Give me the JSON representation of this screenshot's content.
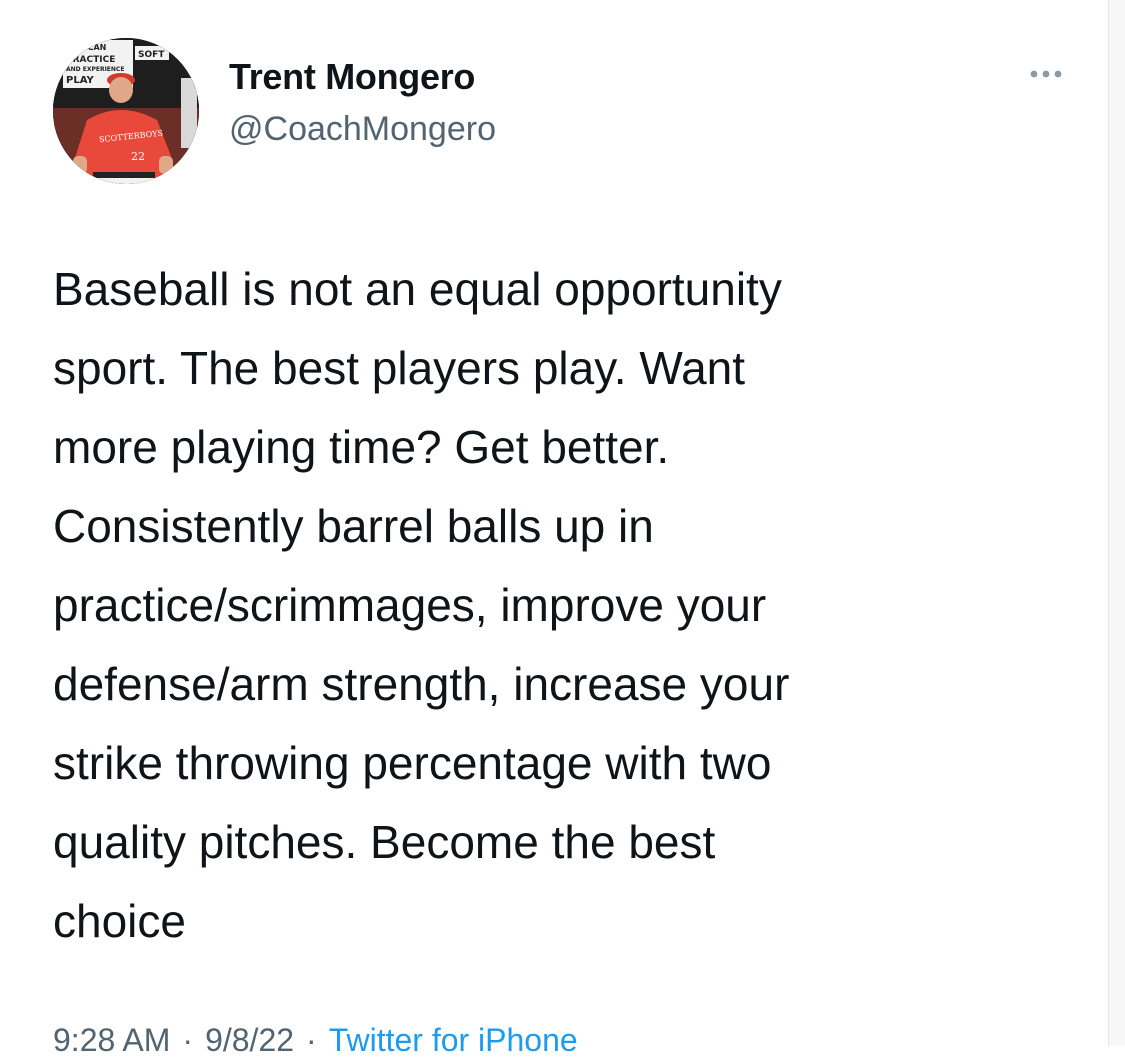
{
  "tweet": {
    "author": {
      "display_name": "Trent Mongero",
      "handle": "@CoachMongero"
    },
    "body": "Baseball is not an equal opportunity\nsport. The best players play. Want\nmore playing time? Get better.\nConsistently barrel balls up in\npractice/scrimmages, improve your\ndefense/arm strength, increase your\nstrike throwing percentage with two\nquality pitches. Become the best\nchoice",
    "meta": {
      "time": "9:28 AM",
      "separator": "·",
      "date": "9/8/22",
      "source": "Twitter for iPhone"
    },
    "more_icon": "more-horizontal-icon"
  },
  "avatar_image": {
    "sign_text": [
      "YOU CAN",
      "PRACTICE",
      "AND EXPERIENCE",
      "PLAY",
      "SOFT"
    ],
    "jersey_text": "SCOTTERBOYS",
    "jersey_number": "22"
  },
  "colors": {
    "text_primary": "#0f1419",
    "text_secondary": "#536471",
    "link": "#1d9bf0",
    "jersey_red": "#e8493a"
  }
}
